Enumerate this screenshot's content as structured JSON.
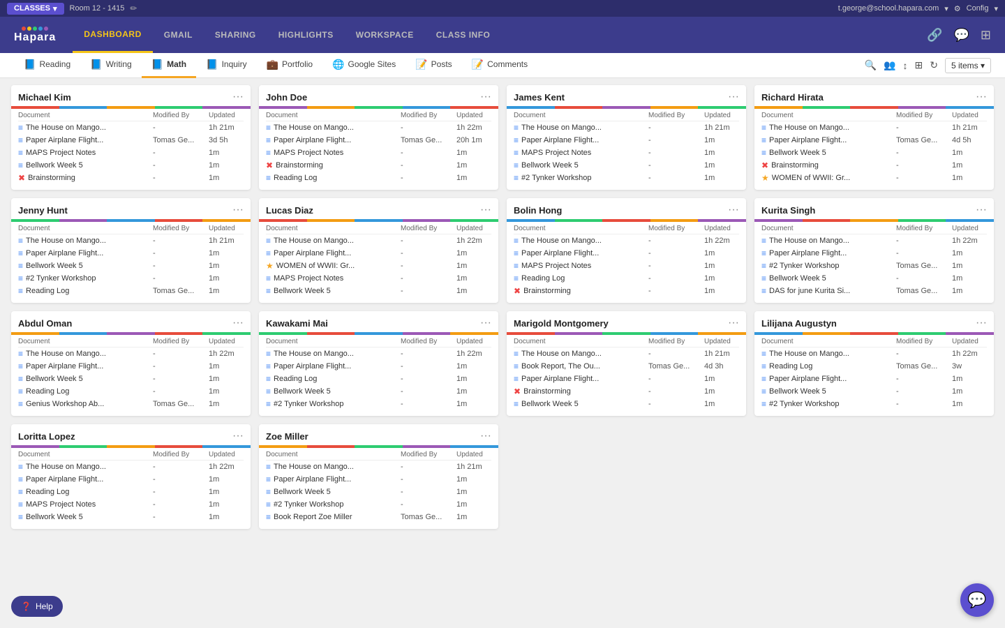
{
  "topbar": {
    "classes_label": "CLASSES",
    "room_label": "Room 12 - 1415",
    "user_email": "t.george@school.hapara.com",
    "config_label": "Config"
  },
  "navbar": {
    "logo": "Hapara",
    "links": [
      {
        "label": "DASHBOARD",
        "active": true
      },
      {
        "label": "GMAIL",
        "active": false
      },
      {
        "label": "SHARING",
        "active": false
      },
      {
        "label": "HIGHLIGHTS",
        "active": false
      },
      {
        "label": "WORKSPACE",
        "active": false
      },
      {
        "label": "CLASS INFO",
        "active": false
      }
    ]
  },
  "subtabs": {
    "tabs": [
      {
        "label": "Reading",
        "active": false,
        "icon": "📘"
      },
      {
        "label": "Writing",
        "active": false,
        "icon": "📘"
      },
      {
        "label": "Math",
        "active": true,
        "icon": "📘"
      },
      {
        "label": "Inquiry",
        "active": false,
        "icon": "📘"
      },
      {
        "label": "Portfolio",
        "active": false,
        "icon": "💼"
      },
      {
        "label": "Google Sites",
        "active": false,
        "icon": "🌐"
      },
      {
        "label": "Posts",
        "active": false,
        "icon": "📝"
      },
      {
        "label": "Comments",
        "active": false,
        "icon": "📝"
      }
    ],
    "items_label": "5 items ▾"
  },
  "columns": {
    "document": "Document",
    "modified_by": "Modified By",
    "updated": "Updated"
  },
  "students": [
    {
      "name": "Michael Kim",
      "docs": [
        {
          "icon": "blue",
          "name": "The House on Mango...",
          "modified_by": "-",
          "updated": "1h 21m"
        },
        {
          "icon": "blue",
          "name": "Paper Airplane Flight...",
          "modified_by": "Tomas Ge...",
          "updated": "3d 5h"
        },
        {
          "icon": "blue",
          "name": "MAPS Project Notes",
          "modified_by": "-",
          "updated": "1m"
        },
        {
          "icon": "blue",
          "name": "Bellwork Week 5",
          "modified_by": "-",
          "updated": "1m"
        },
        {
          "icon": "red",
          "name": "Brainstorming",
          "modified_by": "-",
          "updated": "1m"
        }
      ]
    },
    {
      "name": "John Doe",
      "docs": [
        {
          "icon": "blue",
          "name": "The House on Mango...",
          "modified_by": "-",
          "updated": "1h 22m"
        },
        {
          "icon": "blue",
          "name": "Paper Airplane Flight...",
          "modified_by": "Tomas Ge...",
          "updated": "20h 1m"
        },
        {
          "icon": "blue",
          "name": "MAPS Project Notes",
          "modified_by": "-",
          "updated": "1m"
        },
        {
          "icon": "red",
          "name": "Brainstorming",
          "modified_by": "-",
          "updated": "1m"
        },
        {
          "icon": "blue",
          "name": "Reading Log",
          "modified_by": "-",
          "updated": "1m"
        }
      ]
    },
    {
      "name": "James Kent",
      "docs": [
        {
          "icon": "blue",
          "name": "The House on Mango...",
          "modified_by": "-",
          "updated": "1h 21m"
        },
        {
          "icon": "blue",
          "name": "Paper Airplane Flight...",
          "modified_by": "-",
          "updated": "1m"
        },
        {
          "icon": "blue",
          "name": "MAPS Project Notes",
          "modified_by": "-",
          "updated": "1m"
        },
        {
          "icon": "blue",
          "name": "Bellwork Week 5",
          "modified_by": "-",
          "updated": "1m"
        },
        {
          "icon": "blue",
          "name": "#2 Tynker Workshop",
          "modified_by": "-",
          "updated": "1m"
        }
      ]
    },
    {
      "name": "Richard Hirata",
      "docs": [
        {
          "icon": "blue",
          "name": "The House on Mango...",
          "modified_by": "-",
          "updated": "1h 21m"
        },
        {
          "icon": "blue",
          "name": "Paper Airplane Flight...",
          "modified_by": "Tomas Ge...",
          "updated": "4d 5h"
        },
        {
          "icon": "blue",
          "name": "Bellwork Week 5",
          "modified_by": "-",
          "updated": "1m"
        },
        {
          "icon": "red",
          "name": "Brainstorming",
          "modified_by": "-",
          "updated": "1m"
        },
        {
          "icon": "yellow",
          "name": "WOMEN of WWII: Gr...",
          "modified_by": "-",
          "updated": "1m"
        }
      ]
    },
    {
      "name": "Jenny Hunt",
      "docs": [
        {
          "icon": "blue",
          "name": "The House on Mango...",
          "modified_by": "-",
          "updated": "1h 21m"
        },
        {
          "icon": "blue",
          "name": "Paper Airplane Flight...",
          "modified_by": "-",
          "updated": "1m"
        },
        {
          "icon": "blue",
          "name": "Bellwork Week 5",
          "modified_by": "-",
          "updated": "1m"
        },
        {
          "icon": "blue",
          "name": "#2 Tynker Workshop",
          "modified_by": "-",
          "updated": "1m"
        },
        {
          "icon": "blue",
          "name": "Reading Log",
          "modified_by": "Tomas Ge...",
          "updated": "1m"
        }
      ]
    },
    {
      "name": "Lucas Diaz",
      "docs": [
        {
          "icon": "blue",
          "name": "The House on Mango...",
          "modified_by": "-",
          "updated": "1h 22m"
        },
        {
          "icon": "blue",
          "name": "Paper Airplane Flight...",
          "modified_by": "-",
          "updated": "1m"
        },
        {
          "icon": "yellow",
          "name": "WOMEN of WWII: Gr...",
          "modified_by": "-",
          "updated": "1m"
        },
        {
          "icon": "blue",
          "name": "MAPS Project Notes",
          "modified_by": "-",
          "updated": "1m"
        },
        {
          "icon": "blue",
          "name": "Bellwork Week 5",
          "modified_by": "-",
          "updated": "1m"
        }
      ]
    },
    {
      "name": "Bolin Hong",
      "docs": [
        {
          "icon": "blue",
          "name": "The House on Mango...",
          "modified_by": "-",
          "updated": "1h 22m"
        },
        {
          "icon": "blue",
          "name": "Paper Airplane Flight...",
          "modified_by": "-",
          "updated": "1m"
        },
        {
          "icon": "blue",
          "name": "MAPS Project Notes",
          "modified_by": "-",
          "updated": "1m"
        },
        {
          "icon": "blue",
          "name": "Reading Log",
          "modified_by": "-",
          "updated": "1m"
        },
        {
          "icon": "red",
          "name": "Brainstorming",
          "modified_by": "-",
          "updated": "1m"
        }
      ]
    },
    {
      "name": "Kurita Singh",
      "docs": [
        {
          "icon": "blue",
          "name": "The House on Mango...",
          "modified_by": "-",
          "updated": "1h 22m"
        },
        {
          "icon": "blue",
          "name": "Paper Airplane Flight...",
          "modified_by": "-",
          "updated": "1m"
        },
        {
          "icon": "blue",
          "name": "#2 Tynker Workshop",
          "modified_by": "Tomas Ge...",
          "updated": "1m"
        },
        {
          "icon": "blue",
          "name": "Bellwork Week 5",
          "modified_by": "-",
          "updated": "1m"
        },
        {
          "icon": "blue",
          "name": "DAS for june Kurita Si...",
          "modified_by": "Tomas Ge...",
          "updated": "1m"
        }
      ]
    },
    {
      "name": "Abdul Oman",
      "docs": [
        {
          "icon": "blue",
          "name": "The House on Mango...",
          "modified_by": "-",
          "updated": "1h 22m"
        },
        {
          "icon": "blue",
          "name": "Paper Airplane Flight...",
          "modified_by": "-",
          "updated": "1m"
        },
        {
          "icon": "blue",
          "name": "Bellwork Week 5",
          "modified_by": "-",
          "updated": "1m"
        },
        {
          "icon": "blue",
          "name": "Reading Log",
          "modified_by": "-",
          "updated": "1m"
        },
        {
          "icon": "blue",
          "name": "Genius Workshop Ab...",
          "modified_by": "Tomas Ge...",
          "updated": "1m"
        }
      ]
    },
    {
      "name": "Kawakami Mai",
      "docs": [
        {
          "icon": "blue",
          "name": "The House on Mango...",
          "modified_by": "-",
          "updated": "1h 22m"
        },
        {
          "icon": "blue",
          "name": "Paper Airplane Flight...",
          "modified_by": "-",
          "updated": "1m"
        },
        {
          "icon": "blue",
          "name": "Reading Log",
          "modified_by": "-",
          "updated": "1m"
        },
        {
          "icon": "blue",
          "name": "Bellwork Week 5",
          "modified_by": "-",
          "updated": "1m"
        },
        {
          "icon": "blue",
          "name": "#2 Tynker Workshop",
          "modified_by": "-",
          "updated": "1m"
        }
      ]
    },
    {
      "name": "Marigold Montgomery",
      "docs": [
        {
          "icon": "blue",
          "name": "The House on Mango...",
          "modified_by": "-",
          "updated": "1h 21m"
        },
        {
          "icon": "blue",
          "name": "Book Report, The Ou...",
          "modified_by": "Tomas Ge...",
          "updated": "4d 3h"
        },
        {
          "icon": "blue",
          "name": "Paper Airplane Flight...",
          "modified_by": "-",
          "updated": "1m"
        },
        {
          "icon": "red",
          "name": "Brainstorming",
          "modified_by": "-",
          "updated": "1m"
        },
        {
          "icon": "blue",
          "name": "Bellwork Week 5",
          "modified_by": "-",
          "updated": "1m"
        }
      ]
    },
    {
      "name": "Lilijana Augustyn",
      "docs": [
        {
          "icon": "blue",
          "name": "The House on Mango...",
          "modified_by": "-",
          "updated": "1h 22m"
        },
        {
          "icon": "blue",
          "name": "Reading Log",
          "modified_by": "Tomas Ge...",
          "updated": "3w"
        },
        {
          "icon": "blue",
          "name": "Paper Airplane Flight...",
          "modified_by": "-",
          "updated": "1m"
        },
        {
          "icon": "blue",
          "name": "Bellwork Week 5",
          "modified_by": "-",
          "updated": "1m"
        },
        {
          "icon": "blue",
          "name": "#2 Tynker Workshop",
          "modified_by": "-",
          "updated": "1m"
        }
      ]
    },
    {
      "name": "Loritta Lopez",
      "docs": [
        {
          "icon": "blue",
          "name": "The House on Mango...",
          "modified_by": "-",
          "updated": "1h 22m"
        },
        {
          "icon": "blue",
          "name": "Paper Airplane Flight...",
          "modified_by": "-",
          "updated": "1m"
        },
        {
          "icon": "blue",
          "name": "Reading Log",
          "modified_by": "-",
          "updated": "1m"
        },
        {
          "icon": "blue",
          "name": "MAPS Project Notes",
          "modified_by": "-",
          "updated": "1m"
        },
        {
          "icon": "blue",
          "name": "Bellwork Week 5",
          "modified_by": "-",
          "updated": "1m"
        }
      ]
    },
    {
      "name": "Zoe Miller",
      "docs": [
        {
          "icon": "blue",
          "name": "The House on Mango...",
          "modified_by": "-",
          "updated": "1h 21m"
        },
        {
          "icon": "blue",
          "name": "Paper Airplane Flight...",
          "modified_by": "-",
          "updated": "1m"
        },
        {
          "icon": "blue",
          "name": "Bellwork Week 5",
          "modified_by": "-",
          "updated": "1m"
        },
        {
          "icon": "blue",
          "name": "#2 Tynker Workshop",
          "modified_by": "-",
          "updated": "1m"
        },
        {
          "icon": "blue",
          "name": "Book Report Zoe Miller",
          "modified_by": "Tomas Ge...",
          "updated": "1m"
        }
      ]
    }
  ],
  "help_label": "⓿ Help",
  "colors": {
    "topbar_bg": "#2d2d6b",
    "navbar_bg": "#3c3c8c",
    "active_tab_color": "#f5a623",
    "nav_active_color": "#f5c518"
  }
}
